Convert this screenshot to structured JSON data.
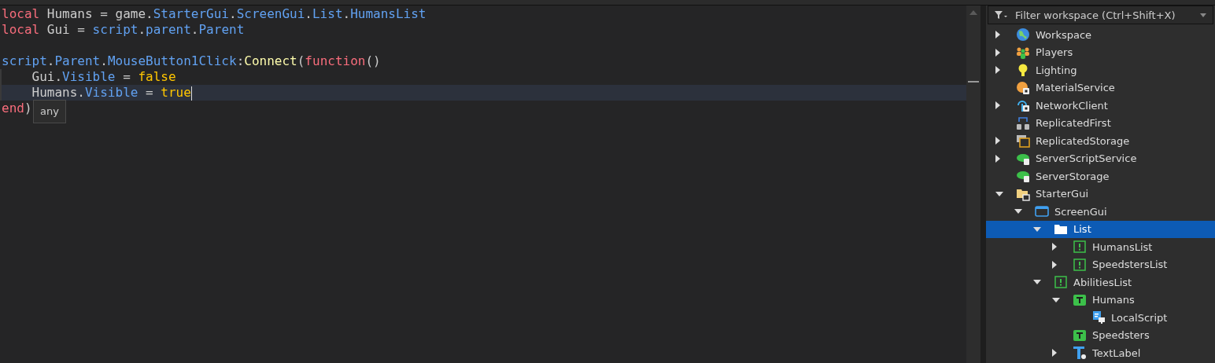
{
  "editor": {
    "lines": [
      {
        "current": false,
        "tokens": [
          {
            "kind": "keyword",
            "text": "local"
          },
          {
            "kind": "plain",
            "text": " Humans = "
          },
          {
            "kind": "plain",
            "text": "game."
          },
          {
            "kind": "prop",
            "text": "StarterGui"
          },
          {
            "kind": "plain",
            "text": "."
          },
          {
            "kind": "prop",
            "text": "ScreenGui"
          },
          {
            "kind": "plain",
            "text": "."
          },
          {
            "kind": "prop",
            "text": "List"
          },
          {
            "kind": "plain",
            "text": "."
          },
          {
            "kind": "prop",
            "text": "HumansList"
          }
        ]
      },
      {
        "current": false,
        "tokens": [
          {
            "kind": "keyword",
            "text": "local"
          },
          {
            "kind": "plain",
            "text": " Gui = "
          },
          {
            "kind": "prop",
            "text": "script"
          },
          {
            "kind": "plain",
            "text": "."
          },
          {
            "kind": "prop",
            "text": "parent"
          },
          {
            "kind": "plain",
            "text": "."
          },
          {
            "kind": "prop",
            "text": "Parent"
          }
        ]
      },
      {
        "current": false
      },
      {
        "current": false,
        "tokens": [
          {
            "kind": "prop",
            "text": "script"
          },
          {
            "kind": "plain",
            "text": "."
          },
          {
            "kind": "prop",
            "text": "Parent"
          },
          {
            "kind": "plain",
            "text": "."
          },
          {
            "kind": "prop",
            "text": "MouseButton1Click"
          },
          {
            "kind": "plain",
            "text": ":"
          },
          {
            "kind": "func",
            "text": "Connect"
          },
          {
            "kind": "plain",
            "text": "("
          },
          {
            "kind": "keyword",
            "text": "function"
          },
          {
            "kind": "plain",
            "text": "()"
          }
        ]
      },
      {
        "current": false,
        "tokens": [
          {
            "kind": "plain",
            "text": "    Gui."
          },
          {
            "kind": "prop",
            "text": "Visible"
          },
          {
            "kind": "plain",
            "text": " = "
          },
          {
            "kind": "bool",
            "text": "false"
          }
        ]
      },
      {
        "current": true,
        "tokens": [
          {
            "kind": "plain",
            "text": "    Humans."
          },
          {
            "kind": "prop",
            "text": "Visible"
          },
          {
            "kind": "plain",
            "text": " = "
          },
          {
            "kind": "bool",
            "text": "true"
          }
        ]
      },
      {
        "current": false,
        "tokens": [
          {
            "kind": "keyword",
            "text": "end"
          },
          {
            "kind": "plain",
            "text": ")"
          }
        ]
      }
    ],
    "tooltip": "any"
  },
  "explorer": {
    "filter": {
      "placeholder": "Filter workspace (Ctrl+Shift+X)"
    },
    "items": [
      {
        "label": "Workspace",
        "kind": "globe",
        "expanded": false,
        "selected": false
      },
      {
        "label": "Players",
        "kind": "players",
        "expanded": false,
        "selected": false
      },
      {
        "label": "Lighting",
        "kind": "bulb",
        "expanded": false,
        "selected": false
      },
      {
        "label": "MaterialService",
        "kind": "material",
        "selected": false
      },
      {
        "label": "NetworkClient",
        "kind": "network",
        "expanded": false,
        "selected": false
      },
      {
        "label": "ReplicatedFirst",
        "kind": "replicated",
        "selected": false
      },
      {
        "label": "ReplicatedStorage",
        "kind": "storage",
        "expanded": false,
        "selected": false
      },
      {
        "label": "ServerScriptService",
        "kind": "cloudscript",
        "expanded": false,
        "selected": false
      },
      {
        "label": "ServerStorage",
        "kind": "cloud",
        "selected": false
      },
      {
        "label": "StarterGui",
        "kind": "foldergui",
        "expanded": true,
        "selected": false,
        "children": [
          {
            "label": "ScreenGui",
            "kind": "screen",
            "expanded": true,
            "selected": false,
            "children": [
              {
                "label": "List",
                "kind": "folder",
                "expanded": true,
                "selected": true,
                "children": [
                  {
                    "label": "HumansList",
                    "kind": "frame",
                    "expanded": false,
                    "selected": false
                  },
                  {
                    "label": "SpeedstersList",
                    "kind": "frame",
                    "expanded": false,
                    "selected": false
                  }
                ]
              },
              {
                "label": "AbilitiesList",
                "kind": "frame",
                "expanded": true,
                "selected": false,
                "children": [
                  {
                    "label": "Humans",
                    "kind": "textbutton",
                    "expanded": true,
                    "selected": false,
                    "children": [
                      {
                        "label": "LocalScript",
                        "kind": "localscript",
                        "selected": false
                      }
                    ]
                  },
                  {
                    "label": "Speedsters",
                    "kind": "textbutton",
                    "selected": false
                  },
                  {
                    "label": "TextLabel",
                    "kind": "textlabel",
                    "expanded": false,
                    "selected": false
                  }
                ]
              }
            ]
          }
        ]
      }
    ]
  }
}
